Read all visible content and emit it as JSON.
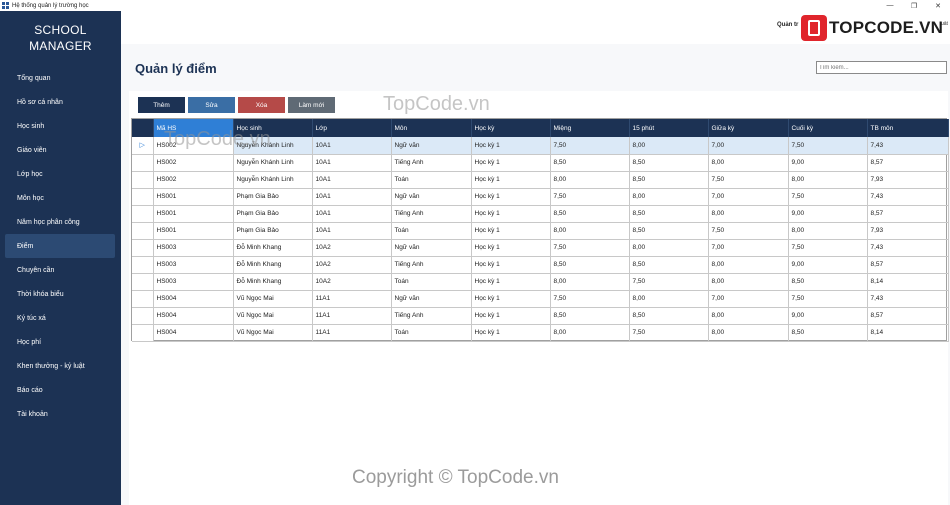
{
  "window": {
    "title": "Hệ thống quản lý trường học",
    "controls": [
      "—",
      "❐",
      "✕"
    ]
  },
  "sidebar": {
    "brand_line1": "SCHOOL",
    "brand_line2": "MANAGER",
    "items": [
      {
        "label": "Tổng quan"
      },
      {
        "label": "Hồ sơ cá nhân"
      },
      {
        "label": "Học sinh"
      },
      {
        "label": "Giáo viên"
      },
      {
        "label": "Lớp học"
      },
      {
        "label": "Môn học"
      },
      {
        "label": "Năm học  phân công"
      },
      {
        "label": "Điểm"
      },
      {
        "label": "Chuyên cần"
      },
      {
        "label": "Thời khóa biểu"
      },
      {
        "label": "Ký túc xá"
      },
      {
        "label": "Học phí"
      },
      {
        "label": "Khen thưởng - kỷ luật"
      },
      {
        "label": "Báo cáo"
      },
      {
        "label": "Tài khoản"
      }
    ]
  },
  "topbar": {
    "user_text": "Quản tr",
    "logo_text": "TOPCODE.VN",
    "logout_label": "uất"
  },
  "main": {
    "title": "Quản lý điểm",
    "search_placeholder": "Tìm kiếm...",
    "buttons": {
      "add": "Thêm",
      "edit": "Sửa",
      "delete": "Xóa",
      "refresh": "Làm mới"
    }
  },
  "table": {
    "columns": [
      "Mã HS",
      "Học sinh",
      "Lớp",
      "Môn",
      "Học kỳ",
      "Miệng",
      "15 phút",
      "Giữa kỳ",
      "Cuối kỳ",
      "TB môn"
    ],
    "rows": [
      [
        "HS002",
        "Nguyễn Khánh Linh",
        "10A1",
        "Ngữ văn",
        "Học kỳ 1",
        "7,50",
        "8,00",
        "7,00",
        "7,50",
        "7,43"
      ],
      [
        "HS002",
        "Nguyễn Khánh Linh",
        "10A1",
        "Tiếng Anh",
        "Học kỳ 1",
        "8,50",
        "8,50",
        "8,00",
        "9,00",
        "8,57"
      ],
      [
        "HS002",
        "Nguyễn Khánh Linh",
        "10A1",
        "Toán",
        "Học kỳ 1",
        "8,00",
        "8,50",
        "7,50",
        "8,00",
        "7,93"
      ],
      [
        "HS001",
        "Phạm Gia Bảo",
        "10A1",
        "Ngữ văn",
        "Học kỳ 1",
        "7,50",
        "8,00",
        "7,00",
        "7,50",
        "7,43"
      ],
      [
        "HS001",
        "Phạm Gia Bảo",
        "10A1",
        "Tiếng Anh",
        "Học kỳ 1",
        "8,50",
        "8,50",
        "8,00",
        "9,00",
        "8,57"
      ],
      [
        "HS001",
        "Phạm Gia Bảo",
        "10A1",
        "Toán",
        "Học kỳ 1",
        "8,00",
        "8,50",
        "7,50",
        "8,00",
        "7,93"
      ],
      [
        "HS003",
        "Đỗ Minh Khang",
        "10A2",
        "Ngữ văn",
        "Học kỳ 1",
        "7,50",
        "8,00",
        "7,00",
        "7,50",
        "7,43"
      ],
      [
        "HS003",
        "Đỗ Minh Khang",
        "10A2",
        "Tiếng Anh",
        "Học kỳ 1",
        "8,50",
        "8,50",
        "8,00",
        "9,00",
        "8,57"
      ],
      [
        "HS003",
        "Đỗ Minh Khang",
        "10A2",
        "Toán",
        "Học kỳ 1",
        "8,00",
        "7,50",
        "8,00",
        "8,50",
        "8,14"
      ],
      [
        "HS004",
        "Vũ Ngọc Mai",
        "11A1",
        "Ngữ văn",
        "Học kỳ 1",
        "7,50",
        "8,00",
        "7,00",
        "7,50",
        "7,43"
      ],
      [
        "HS004",
        "Vũ Ngọc Mai",
        "11A1",
        "Tiếng Anh",
        "Học kỳ 1",
        "8,50",
        "8,50",
        "8,00",
        "9,00",
        "8,57"
      ],
      [
        "HS004",
        "Vũ Ngọc Mai",
        "11A1",
        "Toán",
        "Học kỳ 1",
        "8,00",
        "7,50",
        "8,00",
        "8,50",
        "8,14"
      ]
    ]
  },
  "watermarks": {
    "wm1": "TopCode.vn",
    "wm2": "TopCode.vn",
    "copyright": "Copyright © TopCode.vn"
  },
  "colors": {
    "sidebar": "#1c3254",
    "accent": "#2f7fd6",
    "delete": "#b54a48"
  }
}
